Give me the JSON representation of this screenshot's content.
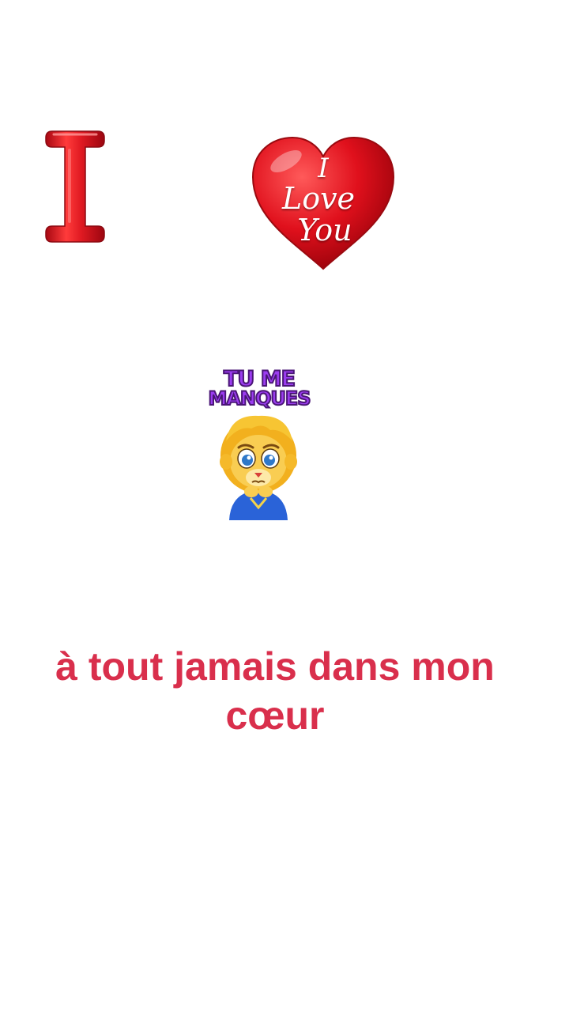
{
  "stickers": {
    "letter": {
      "text": "I",
      "icon": "letter-i-sticker"
    },
    "heart": {
      "line1": "I",
      "line2": "Love",
      "line3": "You",
      "icon": "heart-sticker"
    },
    "missing_you": {
      "line1": "TU ME",
      "line2": "MANQUES",
      "icon": "lion-cub-sticker"
    }
  },
  "caption": {
    "line1": "à tout jamais dans mon",
    "line2": "cœur"
  },
  "colors": {
    "caption": "#d92f4c",
    "heart": "#e0101c",
    "letter": "#e01a22",
    "sticker_caption": "#9b3cf0",
    "background": "#ffffff"
  }
}
